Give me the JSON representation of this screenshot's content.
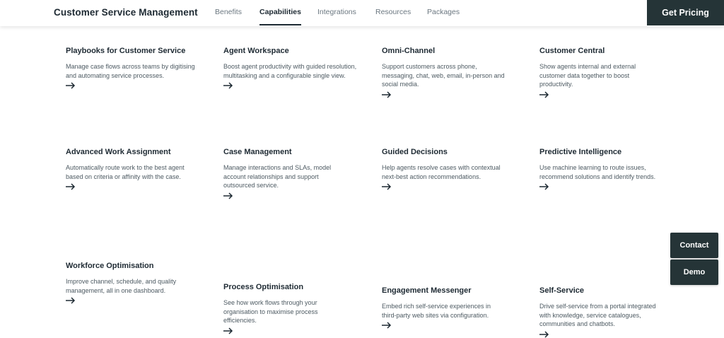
{
  "header": {
    "brand": "Customer Service Management",
    "nav": [
      {
        "label": "Benefits",
        "active": false
      },
      {
        "label": "Capabilities",
        "active": true
      },
      {
        "label": "Integrations",
        "active": false
      },
      {
        "label": "Resources",
        "active": false
      },
      {
        "label": "Packages",
        "active": false
      }
    ],
    "cta": "Get Pricing"
  },
  "cards": [
    {
      "title": "Playbooks for Customer Service",
      "desc": "Manage case flows across teams by digitising and automating service processes."
    },
    {
      "title": "Agent Workspace",
      "desc": "Boost agent productivity with guided resolution, multitasking and a configurable single view."
    },
    {
      "title": "Omni-Channel",
      "desc": "Support customers across phone, messaging, chat, web, email, in-person and social media."
    },
    {
      "title": "Customer Central",
      "desc": "Show agents internal and external customer data together to boost productivity."
    },
    {
      "title": "Advanced Work Assignment",
      "desc": "Automatically route work to the best agent based on criteria or affinity with the case."
    },
    {
      "title": "Case Management",
      "desc": "Manage interactions and SLAs, model account relationships and support outsourced service."
    },
    {
      "title": "Guided Decisions",
      "desc": "Help agents resolve cases with contextual next-best action recommendations."
    },
    {
      "title": "Predictive Intelligence",
      "desc": "Use machine learning to route issues, recommend solutions and identify trends."
    },
    {
      "title": "Workforce Optimisation",
      "desc": "Improve channel, schedule, and quality management, all in one dashboard."
    },
    {
      "title": "Process Optimisation",
      "desc": "See how work flows through your organisation to maximise process efficiencies."
    },
    {
      "title": "Engagement Messenger",
      "desc": "Embed rich self-service experiences in third-party web sites via configuration."
    },
    {
      "title": "Self-Service",
      "desc": "Drive self-service from a portal integrated with knowledge, service catalogues, communities and chatbots."
    }
  ],
  "side_buttons": {
    "contact": "Contact",
    "demo": "Demo"
  },
  "icons": {
    "arrow": "arrow-right-icon"
  },
  "colors": {
    "dark": "#253437",
    "text": "#1e2a33"
  }
}
